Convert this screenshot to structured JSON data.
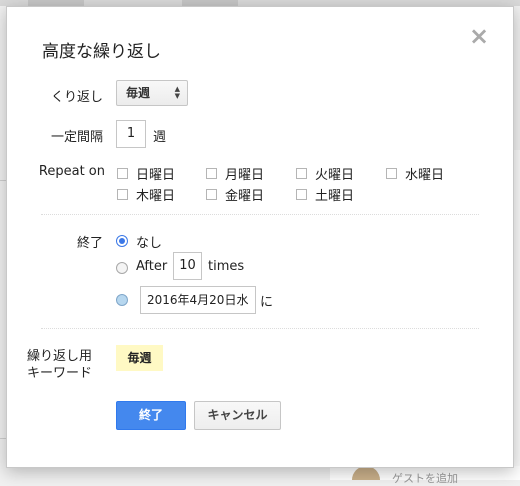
{
  "dialog": {
    "title": "高度な繰り返し",
    "close_icon": "×"
  },
  "repeat": {
    "label": "くり返し",
    "selected": "毎週"
  },
  "interval": {
    "label": "一定間隔",
    "value": "1",
    "unit": "週"
  },
  "repeat_on": {
    "label": "Repeat on",
    "days": [
      {
        "label": "日曜日",
        "checked": false
      },
      {
        "label": "月曜日",
        "checked": false
      },
      {
        "label": "火曜日",
        "checked": false
      },
      {
        "label": "水曜日",
        "checked": false
      },
      {
        "label": "木曜日",
        "checked": false
      },
      {
        "label": "金曜日",
        "checked": false
      },
      {
        "label": "土曜日",
        "checked": false
      }
    ]
  },
  "end": {
    "label": "終了",
    "never_label": "なし",
    "after_label": "After",
    "after_value": "10",
    "times_label": "times",
    "on_date_value": "2016年4月20日水",
    "on_date_suffix": "に",
    "selected": "never"
  },
  "keyword": {
    "label_line1": "繰り返し用",
    "label_line2": "キーワード",
    "value": "毎週"
  },
  "buttons": {
    "done": "終了",
    "cancel": "キャンセル"
  },
  "background": {
    "bottom_text": "ゲストを追加"
  },
  "colors": {
    "primary": "#4488ee",
    "keyword_bg": "#fff9c4"
  }
}
